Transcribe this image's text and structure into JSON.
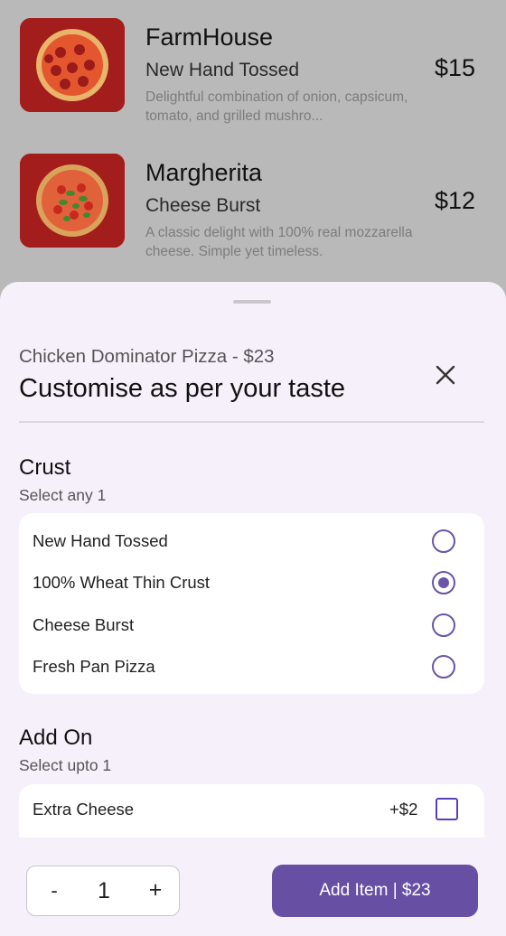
{
  "menu": {
    "items": [
      {
        "name": "FarmHouse",
        "crust": "New Hand Tossed",
        "description": "Delightful combination of onion, capsicum, tomato, and grilled mushro...",
        "price": "$15",
        "thumb_icon": "pepperoni-pizza-image"
      },
      {
        "name": "Margherita",
        "crust": "Cheese Burst",
        "description": "A classic delight with 100% real mozzarella cheese. Simple yet timeless.",
        "price": "$12",
        "thumb_icon": "margherita-pizza-image"
      }
    ]
  },
  "sheet": {
    "subtitle": "Chicken Dominator Pizza - $23",
    "title": "Customise as per your taste",
    "close_icon": "close-icon",
    "crust": {
      "title": "Crust",
      "subtitle": "Select any 1",
      "options": [
        {
          "label": "New Hand Tossed",
          "selected": false
        },
        {
          "label": "100% Wheat Thin Crust",
          "selected": true
        },
        {
          "label": "Cheese Burst",
          "selected": false
        },
        {
          "label": "Fresh Pan Pizza",
          "selected": false
        }
      ]
    },
    "addon": {
      "title": "Add On",
      "subtitle": "Select upto 1",
      "options": [
        {
          "label": "Extra Cheese",
          "price": "+$2",
          "checked": false
        }
      ]
    },
    "footer": {
      "minus": "-",
      "quantity": "1",
      "plus": "+",
      "add_button": "Add Item | $23"
    }
  },
  "colors": {
    "accent": "#6750a4",
    "sheet_bg": "#f6f0fb",
    "scrim": "#b9b9b9"
  }
}
